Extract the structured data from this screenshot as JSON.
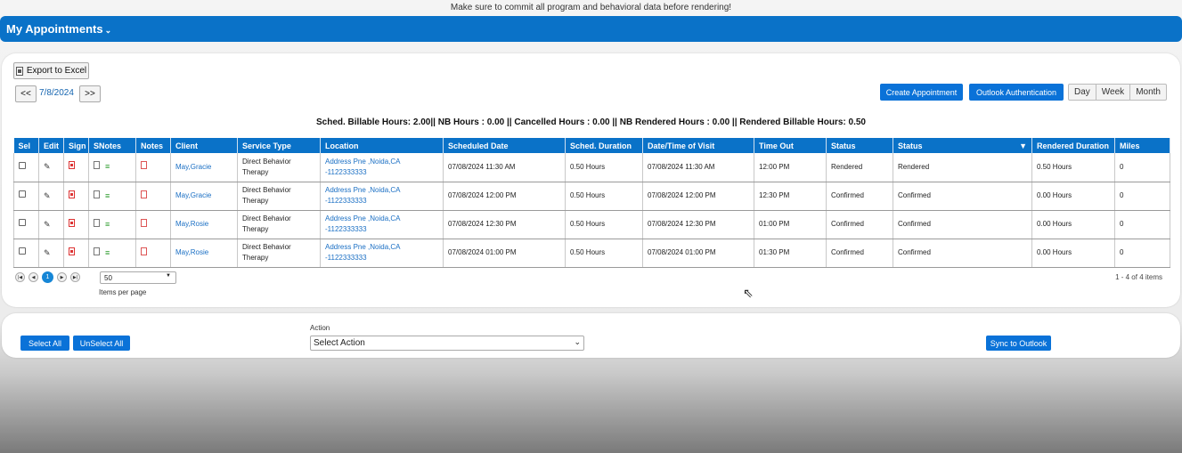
{
  "notice": "Make sure to commit all program and behavioral data before rendering!",
  "header": {
    "title": "My Appointments",
    "chevron": "⌄"
  },
  "toolbar": {
    "export_label": "Export to Excel",
    "prev_label": "<<",
    "next_label": ">>",
    "date": "7/8/2024",
    "create_label": "Create Appointment",
    "outlook_auth_label": "Outlook Authentication",
    "views": [
      "Day",
      "Week",
      "Month"
    ]
  },
  "summary": "Sched. Billable Hours: 2.00|| NB Hours : 0.00 || Cancelled Hours : 0.00 || NB Rendered Hours : 0.00 || Rendered Billable Hours: 0.50",
  "table": {
    "columns": [
      "Sel",
      "Edit",
      "Sign",
      "SNotes",
      "Notes",
      "Client",
      "Service Type",
      "Location",
      "Scheduled Date",
      "Sched. Duration",
      "Date/Time of Visit",
      "Time Out",
      "Status",
      "Status",
      "Rendered Duration",
      "Miles"
    ],
    "rows": [
      {
        "client": "May,Gracie",
        "service1": "Direct Behavior",
        "service2": "Therapy",
        "loc1": "Address Pne ,Noida,CA",
        "loc2": "-1122333333",
        "sched_date": "07/08/2024 11:30 AM",
        "duration": "0.50 Hours",
        "visit": "07/08/2024 11:30 AM",
        "time_out": "12:00 PM",
        "status1": "Rendered",
        "status2": "Rendered",
        "rendered": "0.50 Hours",
        "miles": "0"
      },
      {
        "client": "May,Gracie",
        "service1": "Direct Behavior",
        "service2": "Therapy",
        "loc1": "Address Pne ,Noida,CA",
        "loc2": "-1122333333",
        "sched_date": "07/08/2024 12:00 PM",
        "duration": "0.50 Hours",
        "visit": "07/08/2024 12:00 PM",
        "time_out": "12:30 PM",
        "status1": "Confirmed",
        "status2": "Confirmed",
        "rendered": "0.00 Hours",
        "miles": "0"
      },
      {
        "client": "May,Rosie",
        "service1": "Direct Behavior",
        "service2": "Therapy",
        "loc1": "Address Pne ,Noida,CA",
        "loc2": "-1122333333",
        "sched_date": "07/08/2024 12:30 PM",
        "duration": "0.50 Hours",
        "visit": "07/08/2024 12:30 PM",
        "time_out": "01:00 PM",
        "status1": "Confirmed",
        "status2": "Confirmed",
        "rendered": "0.00 Hours",
        "miles": "0"
      },
      {
        "client": "May,Rosie",
        "service1": "Direct Behavior",
        "service2": "Therapy",
        "loc1": "Address Pne ,Noida,CA",
        "loc2": "-1122333333",
        "sched_date": "07/08/2024 01:00 PM",
        "duration": "0.50 Hours",
        "visit": "07/08/2024 01:00 PM",
        "time_out": "01:30 PM",
        "status1": "Confirmed",
        "status2": "Confirmed",
        "rendered": "0.00 Hours",
        "miles": "0"
      }
    ]
  },
  "pager": {
    "current_page": "1",
    "per_page_value": "50",
    "per_page_label": "Items per page",
    "items_info": "1 - 4 of 4 items"
  },
  "actions": {
    "select_all_label": "Select All",
    "unselect_all_label": "UnSelect All",
    "action_label": "Action",
    "action_select_value": "Select Action",
    "sync_label": "Sync to Outlook"
  },
  "colors": {
    "primary": "#0a72c8",
    "link": "#1a6fc4"
  },
  "icons": {
    "edit": "pencil-icon",
    "sign": "sign-pdf-icon",
    "snotes": [
      "document-icon",
      "list-icon"
    ],
    "notes": "note-pdf-icon",
    "filter": "filter-icon"
  }
}
